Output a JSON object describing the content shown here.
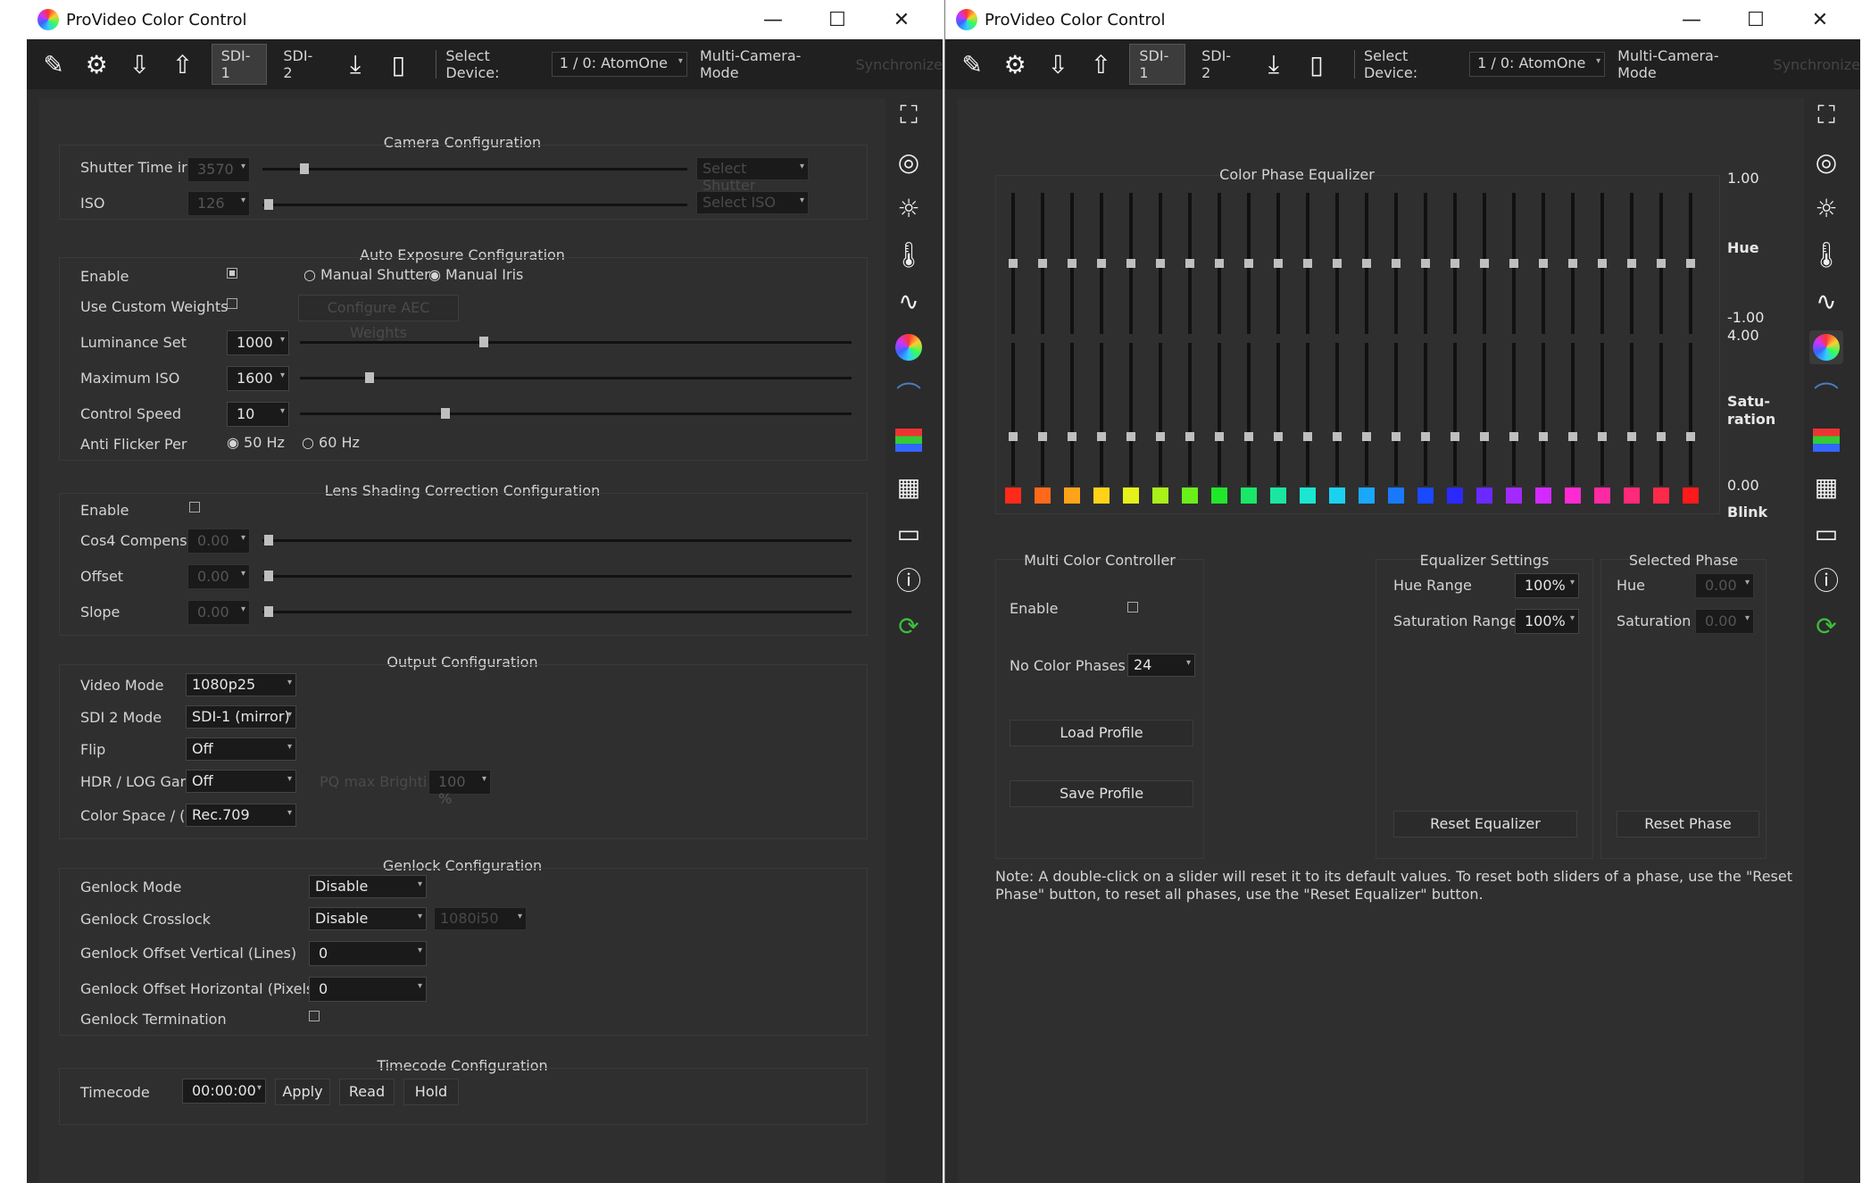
{
  "app": {
    "title": "ProVideo Color Control"
  },
  "toolbar": {
    "sdi1": "SDI-1",
    "sdi2": "SDI-2",
    "select_device_label": "Select Device:",
    "device_value": "1 / 0: AtomOne",
    "multi_camera": "Multi-Camera-Mode",
    "synchronize": "Synchronize"
  },
  "camera": {
    "title": "Camera Configuration",
    "shutter_label": "Shutter Time ir",
    "shutter_value": "3570",
    "shutter_select": "Select Shutter",
    "iso_label": "ISO",
    "iso_value": "126",
    "iso_select": "Select ISO"
  },
  "ae": {
    "title": "Auto Exposure Configuration",
    "enable_label": "Enable",
    "manual_shutter": "Manual Shutter",
    "manual_iris": "Manual Iris",
    "custom_weights_label": "Use Custom Weights",
    "configure_button": "Configure AEC Weights",
    "luminance_label": "Luminance Set",
    "luminance_value": "1000",
    "max_iso_label": "Maximum ISO",
    "max_iso_value": "1600",
    "speed_label": "Control Speed",
    "speed_value": "10",
    "flicker_label": "Anti Flicker Per",
    "flicker_50": "50 Hz",
    "flicker_60": "60 Hz",
    "luminance_pos": 0.33,
    "max_iso_pos": 0.12,
    "speed_pos": 0.26
  },
  "lens": {
    "title": "Lens Shading Correction Configuration",
    "enable_label": "Enable",
    "cos4_label": "Cos4 Compens",
    "cos4_value": "0.00",
    "offset_label": "Offset",
    "offset_value": "0.00",
    "slope_label": "Slope",
    "slope_value": "0.00"
  },
  "output": {
    "title": "Output Configuration",
    "video_mode_label": "Video Mode",
    "video_mode_value": "1080p25",
    "sdi2_mode_label": "SDI 2 Mode",
    "sdi2_mode_value": "SDI-1 (mirror)",
    "flip_label": "Flip",
    "flip_value": "Off",
    "hdr_label": "HDR / LOG Gar",
    "hdr_value": "Off",
    "pq_label": "PQ max Brighti",
    "pq_value": "100 %",
    "color_space_label": "Color Space / (",
    "color_space_value": "Rec.709"
  },
  "genlock": {
    "title": "Genlock Configuration",
    "mode_label": "Genlock Mode",
    "mode_value": "Disable",
    "crosslock_label": "Genlock Crosslock",
    "crosslock_value": "Disable",
    "crosslock_extra": "1080i50",
    "offset_v_label": "Genlock Offset Vertical (Lines)",
    "offset_v_value": "0",
    "offset_h_label": "Genlock Offset Horizontal (Pixels)",
    "offset_h_value": "0",
    "termination_label": "Genlock Termination"
  },
  "timecode": {
    "title": "Timecode Configuration",
    "label": "Timecode",
    "value": "00:00:00",
    "apply": "Apply",
    "read": "Read",
    "hold": "Hold"
  },
  "equalizer": {
    "title": "Color Phase Equalizer",
    "hue_max": "1.00",
    "hue_label": "Hue",
    "hue_min": "-1.00",
    "sat_max": "4.00",
    "sat_label_1": "Satu-",
    "sat_label_2": "ration",
    "sat_min": "0.00",
    "blink_label": "Blink",
    "phase_colors": [
      "#ff2a1a",
      "#ff6a1a",
      "#ffa41a",
      "#ffd21a",
      "#e6f01a",
      "#aaf01a",
      "#6aef1a",
      "#22e62a",
      "#1ae66a",
      "#1ae6a2",
      "#1ae6d2",
      "#1ad2f0",
      "#1aa8ff",
      "#1a78ff",
      "#1a4aff",
      "#2a2aff",
      "#6a2aff",
      "#a22aff",
      "#d22aff",
      "#ff2ad2",
      "#ff2aa2",
      "#ff2a78",
      "#ff2a4a",
      "#ff1a1a"
    ]
  },
  "mcc": {
    "title": "Multi Color Controller",
    "enable_label": "Enable",
    "phases_label": "No Color Phases",
    "phases_value": "24",
    "load_profile": "Load Profile",
    "save_profile": "Save Profile"
  },
  "eq_settings": {
    "title": "Equalizer Settings",
    "hue_range_label": "Hue Range",
    "hue_range_value": "100%",
    "sat_range_label": "Saturation Range",
    "sat_range_value": "100%",
    "reset": "Reset Equalizer"
  },
  "selected_phase": {
    "title": "Selected Phase",
    "hue_label": "Hue",
    "hue_value": "0.00",
    "sat_label": "Saturation",
    "sat_value": "0.00",
    "reset": "Reset Phase"
  },
  "note": {
    "line1": "Note: A double-click on a slider will reset it to its default values. To reset both sliders of a phase, use the \"Reset",
    "line2": "Phase\" button, to reset all phases, use the \"Reset Equalizer\" button."
  }
}
